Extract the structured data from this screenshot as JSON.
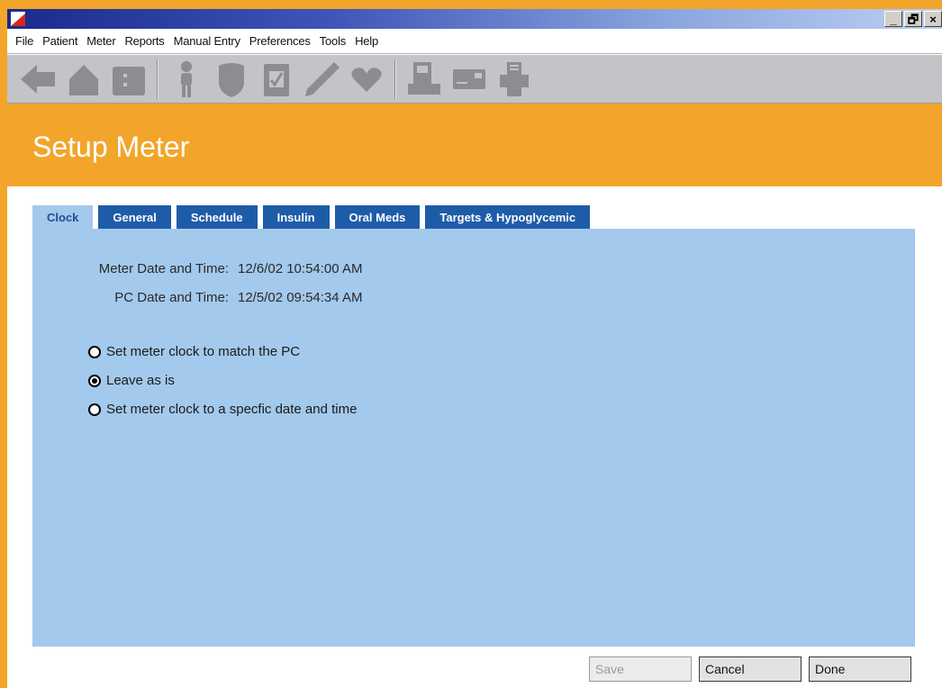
{
  "window": {
    "controls": [
      "_",
      "🗗",
      "×"
    ]
  },
  "menu": [
    "File",
    "Patient",
    "Meter",
    "Reports",
    "Manual Entry",
    "Preferences",
    "Tools",
    "Help"
  ],
  "toolbar": {
    "buttons": [
      {
        "icon": "back-arrow-icon"
      },
      {
        "icon": "home-icon"
      },
      {
        "icon": "folder-icon"
      },
      {
        "icon": "person-icon"
      },
      {
        "icon": "shield-icon"
      },
      {
        "icon": "clipboard-icon"
      },
      {
        "icon": "pen-icon"
      },
      {
        "icon": "heart-icon"
      },
      {
        "icon": "meter-device-icon"
      },
      {
        "icon": "modem-icon"
      },
      {
        "icon": "printer-icon"
      }
    ]
  },
  "header": {
    "title": "Setup Meter"
  },
  "tabs": [
    {
      "label": "Clock",
      "active": true
    },
    {
      "label": "General",
      "active": false
    },
    {
      "label": "Schedule",
      "active": false
    },
    {
      "label": "Insulin",
      "active": false
    },
    {
      "label": "Oral Meds",
      "active": false
    },
    {
      "label": "Targets & Hypoglycemic",
      "active": false
    }
  ],
  "clock": {
    "meter_label": "Meter Date and Time:",
    "meter_value": "12/6/02 10:54:00 AM",
    "pc_label": "PC Date and Time:",
    "pc_value": "12/5/02 09:54:34 AM",
    "options": [
      {
        "label": "Set meter clock to match the PC",
        "selected": false
      },
      {
        "label": "Leave as is",
        "selected": true
      },
      {
        "label": "Set meter clock to a specfic date and time",
        "selected": false
      }
    ]
  },
  "buttons": {
    "save": "Save",
    "cancel": "Cancel",
    "done": "Done"
  },
  "colors": {
    "accent_orange": "#f2a52a",
    "tab_blue": "#1f5ca8",
    "panel_blue": "#a3c9ec"
  }
}
